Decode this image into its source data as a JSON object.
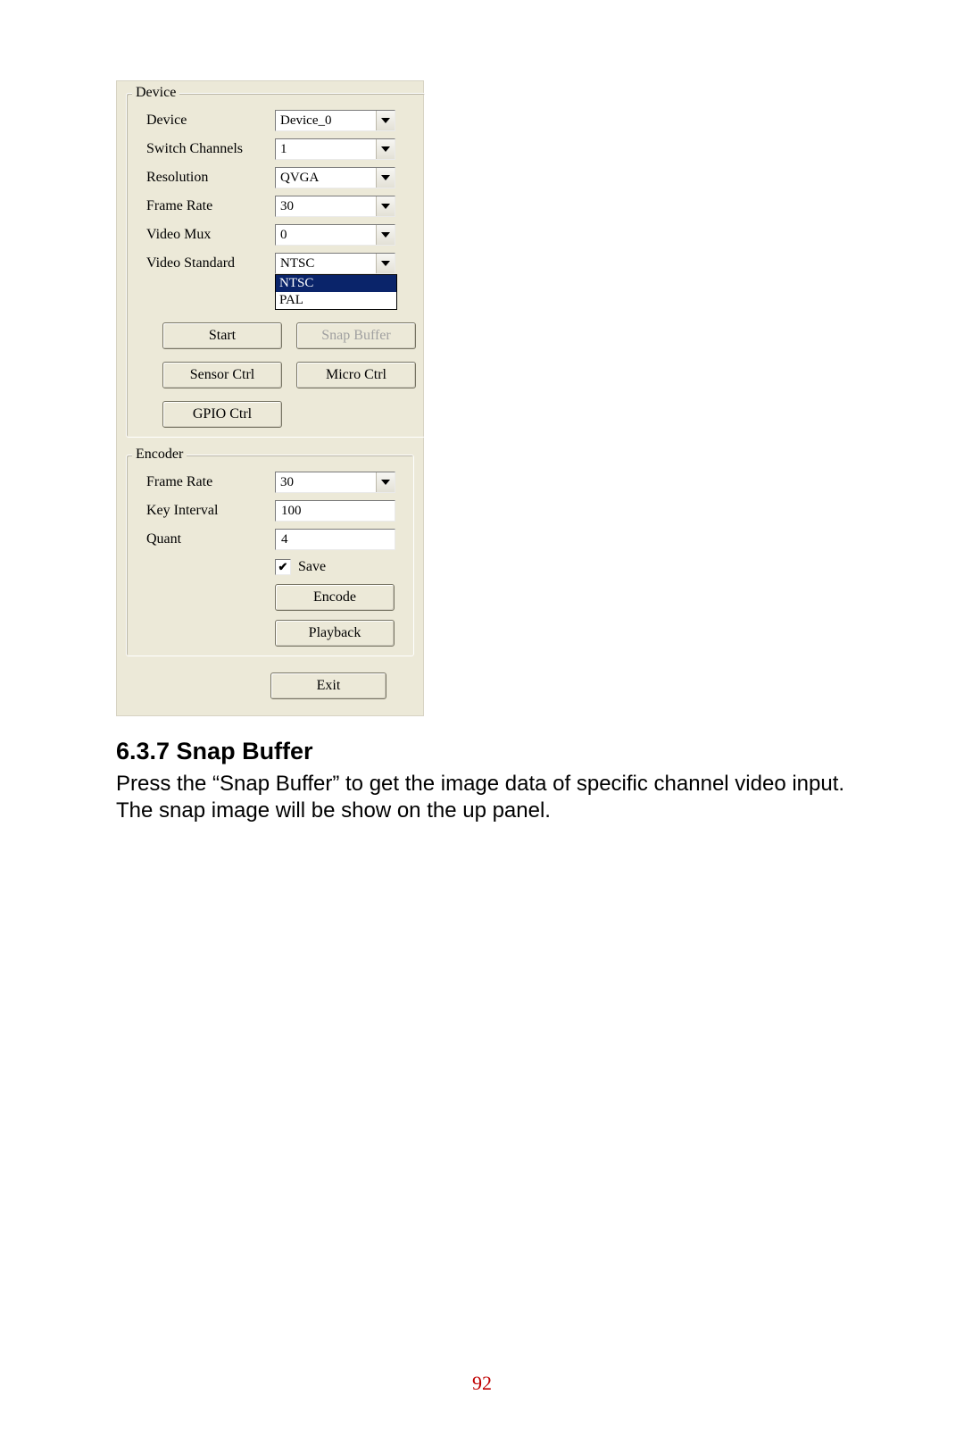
{
  "device_group": {
    "legend": "Device",
    "device_label": "Device",
    "device_value": "Device_0",
    "switch_label": "Switch Channels",
    "switch_value": "1",
    "resolution_label": "Resolution",
    "resolution_value": "QVGA",
    "framerate_label": "Frame Rate",
    "framerate_value": "30",
    "videomux_label": "Video Mux",
    "videomux_value": "0",
    "videostd_label": "Video Standard",
    "videostd_value": "NTSC",
    "videostd_options": [
      "NTSC",
      "PAL"
    ],
    "buttons": {
      "start": "Start",
      "snap_buffer": "Snap Buffer",
      "sensor_ctrl": "Sensor Ctrl",
      "micro_ctrl": "Micro Ctrl",
      "gpio_ctrl": "GPIO Ctrl"
    }
  },
  "encoder_group": {
    "legend": "Encoder",
    "framerate_label": "Frame Rate",
    "framerate_value": "30",
    "keyinterval_label": "Key Interval",
    "keyinterval_value": "100",
    "quant_label": "Quant",
    "quant_value": "4",
    "save_label": "Save",
    "save_checked": true,
    "buttons": {
      "encode": "Encode",
      "playback": "Playback"
    }
  },
  "exit_button": "Exit",
  "doc": {
    "heading": "6.3.7 Snap Buffer",
    "body": "Press the “Snap Buffer” to get the image data of specific channel video input. The snap image will be show on the up panel."
  },
  "page_number": "92"
}
